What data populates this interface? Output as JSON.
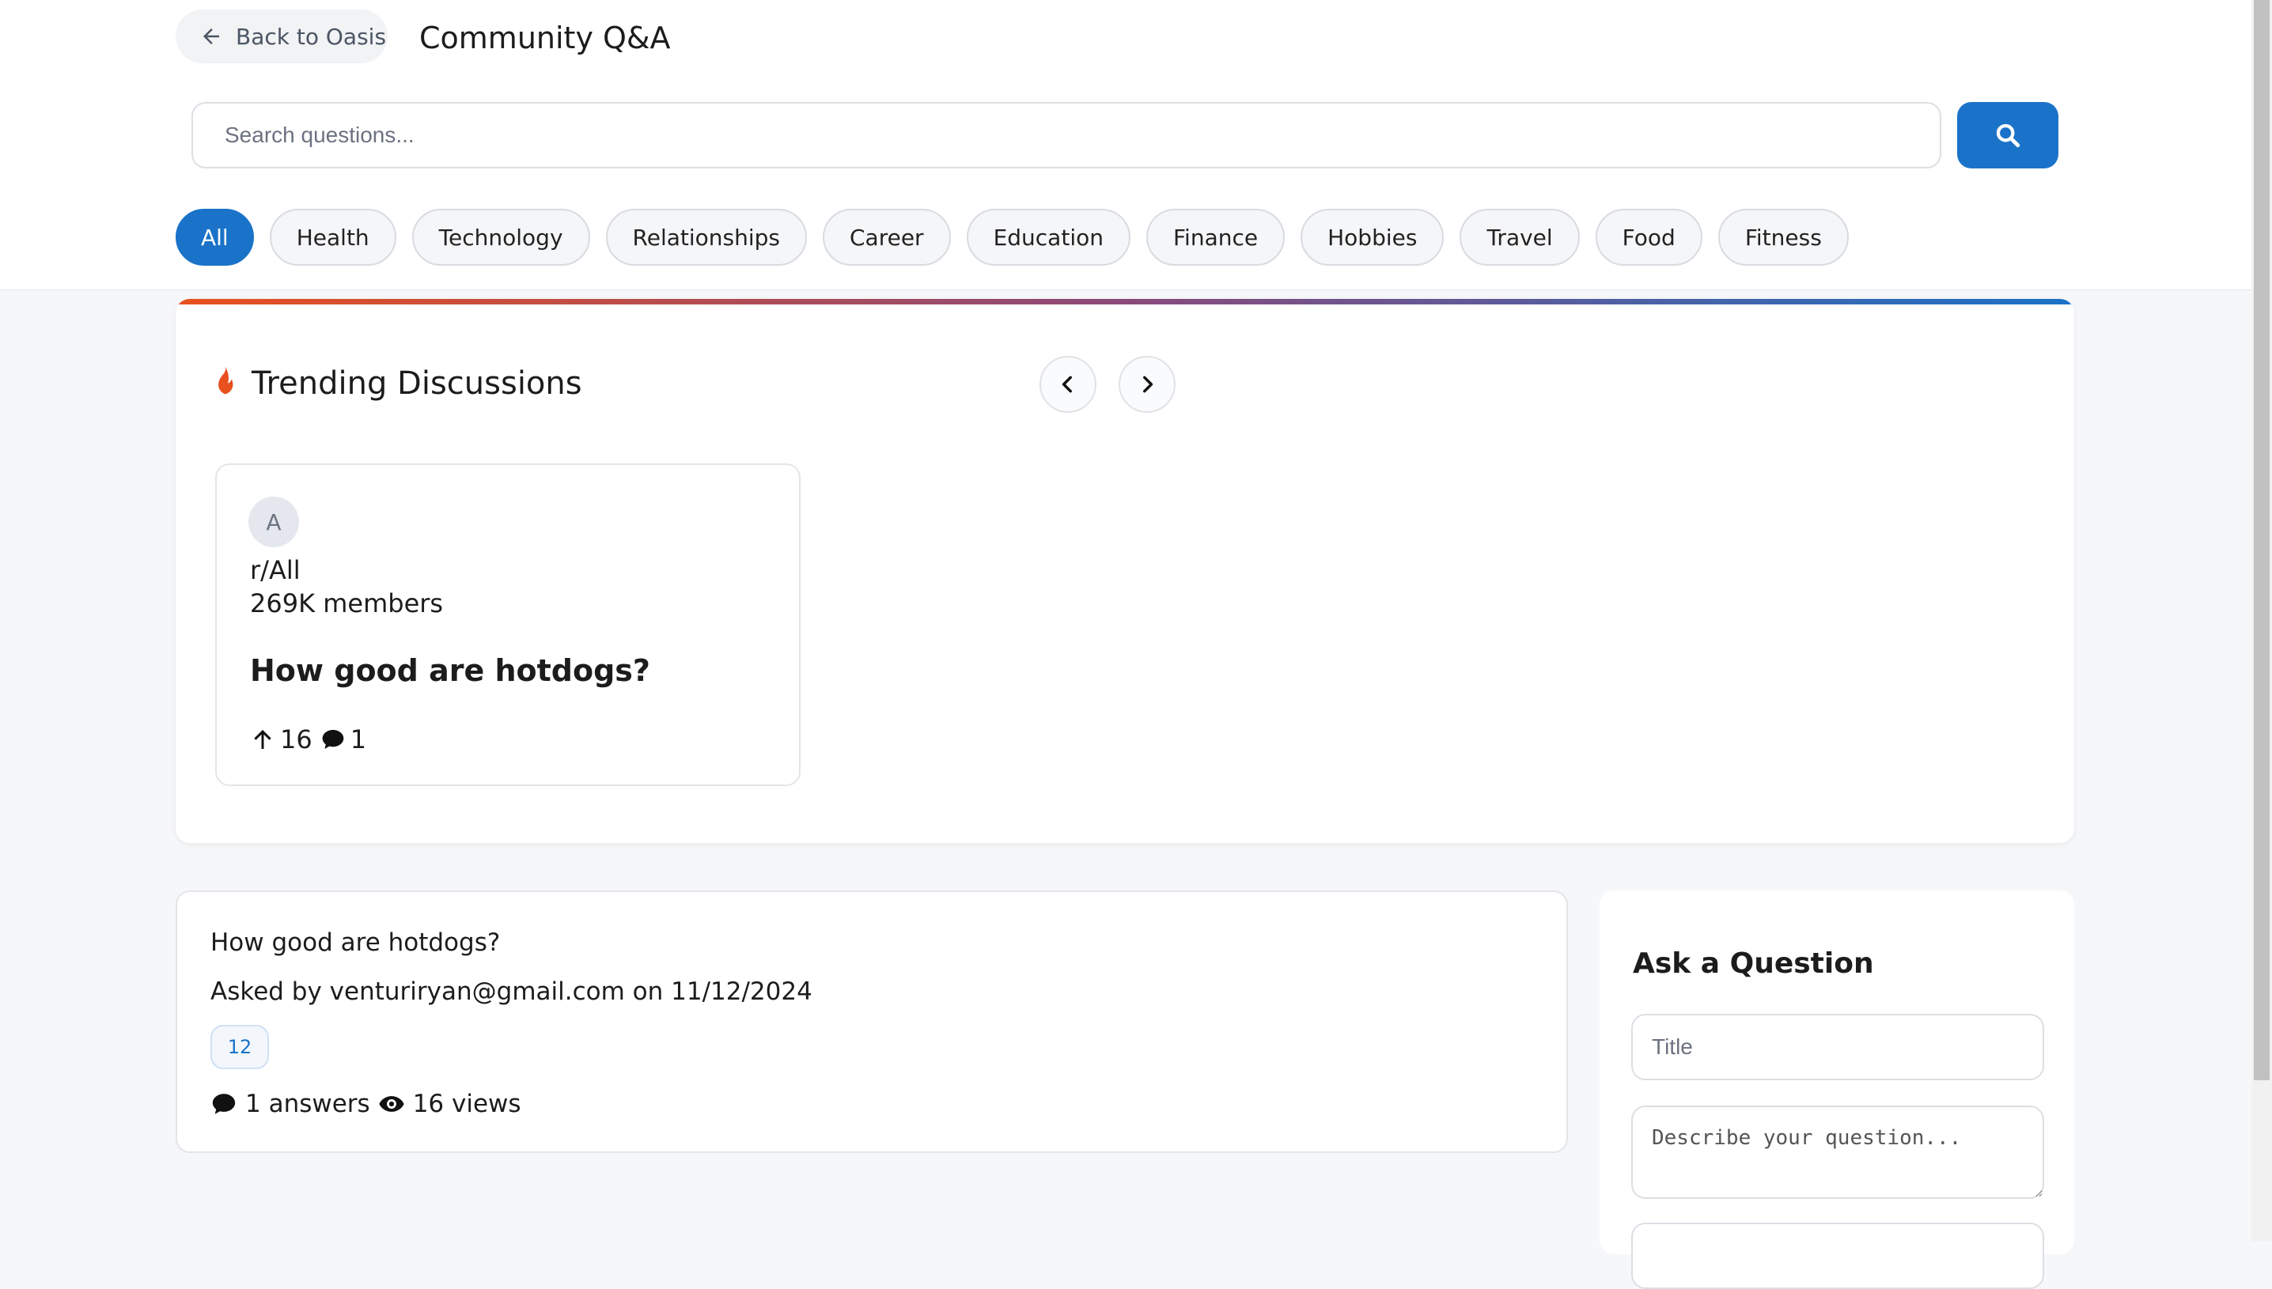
{
  "header": {
    "back_label": "Back to Oasis",
    "title": "Community Q&A"
  },
  "search": {
    "placeholder": "Search questions...",
    "button_icon": "search-icon"
  },
  "categories": [
    {
      "label": "All",
      "active": true
    },
    {
      "label": "Health",
      "active": false
    },
    {
      "label": "Technology",
      "active": false
    },
    {
      "label": "Relationships",
      "active": false
    },
    {
      "label": "Career",
      "active": false
    },
    {
      "label": "Education",
      "active": false
    },
    {
      "label": "Finance",
      "active": false
    },
    {
      "label": "Hobbies",
      "active": false
    },
    {
      "label": "Travel",
      "active": false
    },
    {
      "label": "Food",
      "active": false
    },
    {
      "label": "Fitness",
      "active": false
    }
  ],
  "trending": {
    "title": "Trending Discussions",
    "icon": "fire-icon",
    "prev_icon": "chevron-left-icon",
    "next_icon": "chevron-right-icon",
    "card": {
      "avatar_letter": "A",
      "subreddit": "r/All",
      "members": "269K members",
      "question": "How good are hotdogs?",
      "upvotes": "16",
      "comments": "1"
    }
  },
  "question": {
    "title": "How good are hotdogs?",
    "meta": "Asked by venturiryan@gmail.com on 11/12/2024",
    "tag": "12",
    "answers": "1 answers",
    "views": "16 views"
  },
  "ask": {
    "title": "Ask a Question",
    "title_placeholder": "Title",
    "description_placeholder": "Describe your question..."
  },
  "colors": {
    "accent": "#1a73c8",
    "fire": "#e8501e",
    "background": "#f6f7f9"
  }
}
